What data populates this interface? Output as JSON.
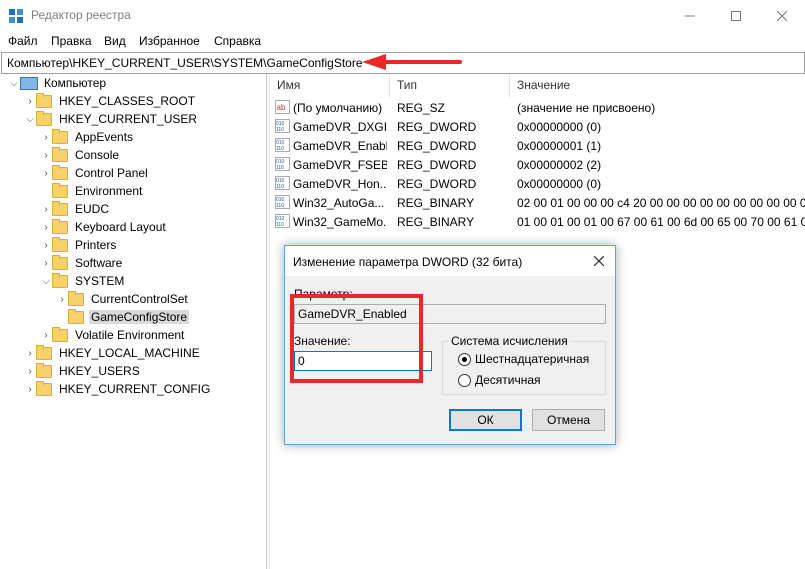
{
  "window": {
    "title": "Редактор реестра"
  },
  "menu": [
    "Файл",
    "Правка",
    "Вид",
    "Избранное",
    "Справка"
  ],
  "address": "Компьютер\\HKEY_CURRENT_USER\\SYSTEM\\GameConfigStore",
  "tree": {
    "root": "Компьютер",
    "hives": [
      "HKEY_CLASSES_ROOT",
      "HKEY_CURRENT_USER",
      "HKEY_LOCAL_MACHINE",
      "HKEY_USERS",
      "HKEY_CURRENT_CONFIG"
    ],
    "hkcu_children": [
      "AppEvents",
      "Console",
      "Control Panel",
      "Environment",
      "EUDC",
      "Keyboard Layout",
      "Printers",
      "Software",
      "SYSTEM",
      "Volatile Environment"
    ],
    "system_children": [
      "CurrentControlSet",
      "GameConfigStore"
    ],
    "selected": "GameConfigStore"
  },
  "list": {
    "columns": [
      "Имя",
      "Тип",
      "Значение"
    ],
    "rows": [
      {
        "name": "(По умолчанию)",
        "type": "REG_SZ",
        "value": "(значение не присвоено)",
        "icon": "string-value-icon"
      },
      {
        "name": "GameDVR_DXGI...",
        "type": "REG_DWORD",
        "value": "0x00000000 (0)",
        "icon": "binary-value-icon"
      },
      {
        "name": "GameDVR_Enabl...",
        "type": "REG_DWORD",
        "value": "0x00000001 (1)",
        "icon": "binary-value-icon"
      },
      {
        "name": "GameDVR_FSEB...",
        "type": "REG_DWORD",
        "value": "0x00000002 (2)",
        "icon": "binary-value-icon"
      },
      {
        "name": "GameDVR_Hon...",
        "type": "REG_DWORD",
        "value": "0x00000000 (0)",
        "icon": "binary-value-icon"
      },
      {
        "name": "Win32_AutoGa...",
        "type": "REG_BINARY",
        "value": "02 00 01 00 00 00 c4 20 00 00 00 00 00 00 00 00 00 00 ...",
        "icon": "binary-value-icon"
      },
      {
        "name": "Win32_GameMo...",
        "type": "REG_BINARY",
        "value": "01 00 01 00 01 00 67 00 61 00 6d 00 65 00 70 00 61 0...",
        "icon": "binary-value-icon"
      }
    ]
  },
  "dialog": {
    "title": "Изменение параметра DWORD (32 бита)",
    "param_label": "Параметр:",
    "param_value": "GameDVR_Enabled",
    "value_label": "Значение:",
    "value": "0",
    "radix_title": "Система исчисления",
    "radix_hex": "Шестнадцатеричная",
    "radix_dec": "Десятичная",
    "ok": "ОК",
    "cancel": "Отмена"
  },
  "annotation_color": "#e8282b"
}
